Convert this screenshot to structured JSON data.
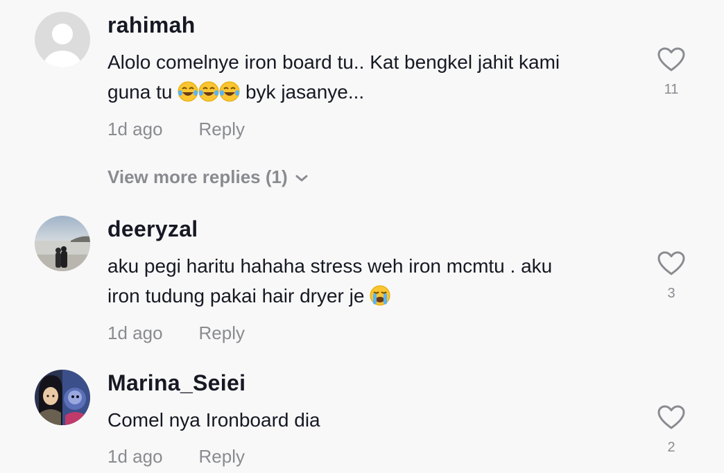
{
  "comments": [
    {
      "username": "rahimah",
      "text_line1": "Alolo comelnye iron board tu.. Kat bengkel jahit kami",
      "text_line2_before": "guna tu ",
      "text_line2_emoji": [
        "face-with-tears-of-joy",
        "face-with-tears-of-joy",
        "face-with-tears-of-joy"
      ],
      "text_line2_after": " byk jasanye...",
      "time": "1d ago",
      "reply_label": "Reply",
      "likes": "11",
      "avatar": "default-avatar"
    },
    {
      "username": "deeryzal",
      "text_line1": "aku pegi haritu hahaha stress weh iron mcmtu . aku",
      "text_line2_before": "iron tudung pakai hair dryer je ",
      "text_line2_emoji": [
        "loudly-crying-face"
      ],
      "time": "1d ago",
      "reply_label": "Reply",
      "likes": "3",
      "avatar": "photo-beach-couple"
    },
    {
      "username": "Marina_Seiei",
      "text_line1": "Comel nya Ironboard dia",
      "time": "1d ago",
      "reply_label": "Reply",
      "likes": "2",
      "avatar": "anime-characters"
    }
  ],
  "view_more": {
    "label": "View more replies (1)",
    "icon": "chevron-down-icon"
  },
  "colors": {
    "background": "#f8f8f8",
    "primary_text": "#161823",
    "secondary_text": "#8a8b91"
  }
}
